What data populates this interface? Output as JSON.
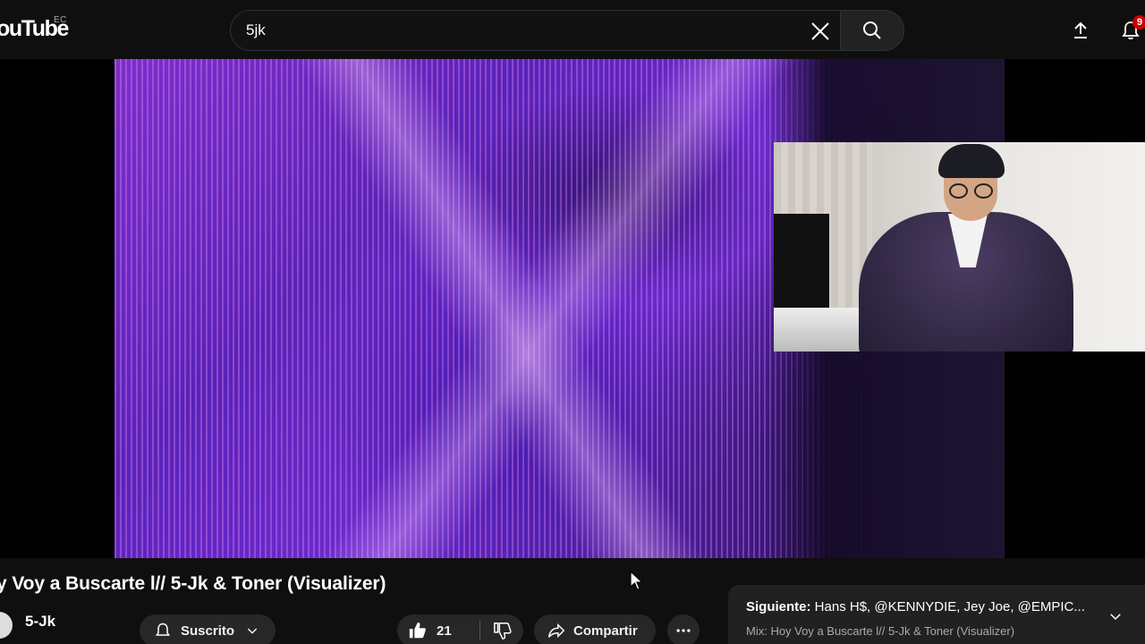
{
  "header": {
    "logo_text": "ouTube",
    "country_code": "EC",
    "search": {
      "value": "5jk"
    },
    "notifications_count": "9"
  },
  "video": {
    "title": "y Voy a Buscarte l// 5-Jk & Toner (Visualizer)",
    "channel_name": "5-Jk",
    "subscribe_label": "Suscrito",
    "like_count": "21",
    "share_label": "Compartir"
  },
  "up_next": {
    "prefix": "Siguiente:",
    "channels": " Hans H$, @KENNYDIE, Jey Joe, @EMPIC...",
    "subtitle": "Mix: Hoy Voy a Buscarte l// 5-Jk & Toner (Visualizer)"
  },
  "icons": [
    "close-icon",
    "search-icon",
    "upload-icon",
    "bell-icon",
    "bell-outline-icon",
    "chevron-down-icon",
    "thumbs-up-icon",
    "thumbs-down-icon",
    "share-icon",
    "more-icon",
    "mouse-cursor-icon"
  ],
  "colors": {
    "background": "#0f0f0f",
    "pill": "#272727",
    "badge": "#cc0000"
  }
}
